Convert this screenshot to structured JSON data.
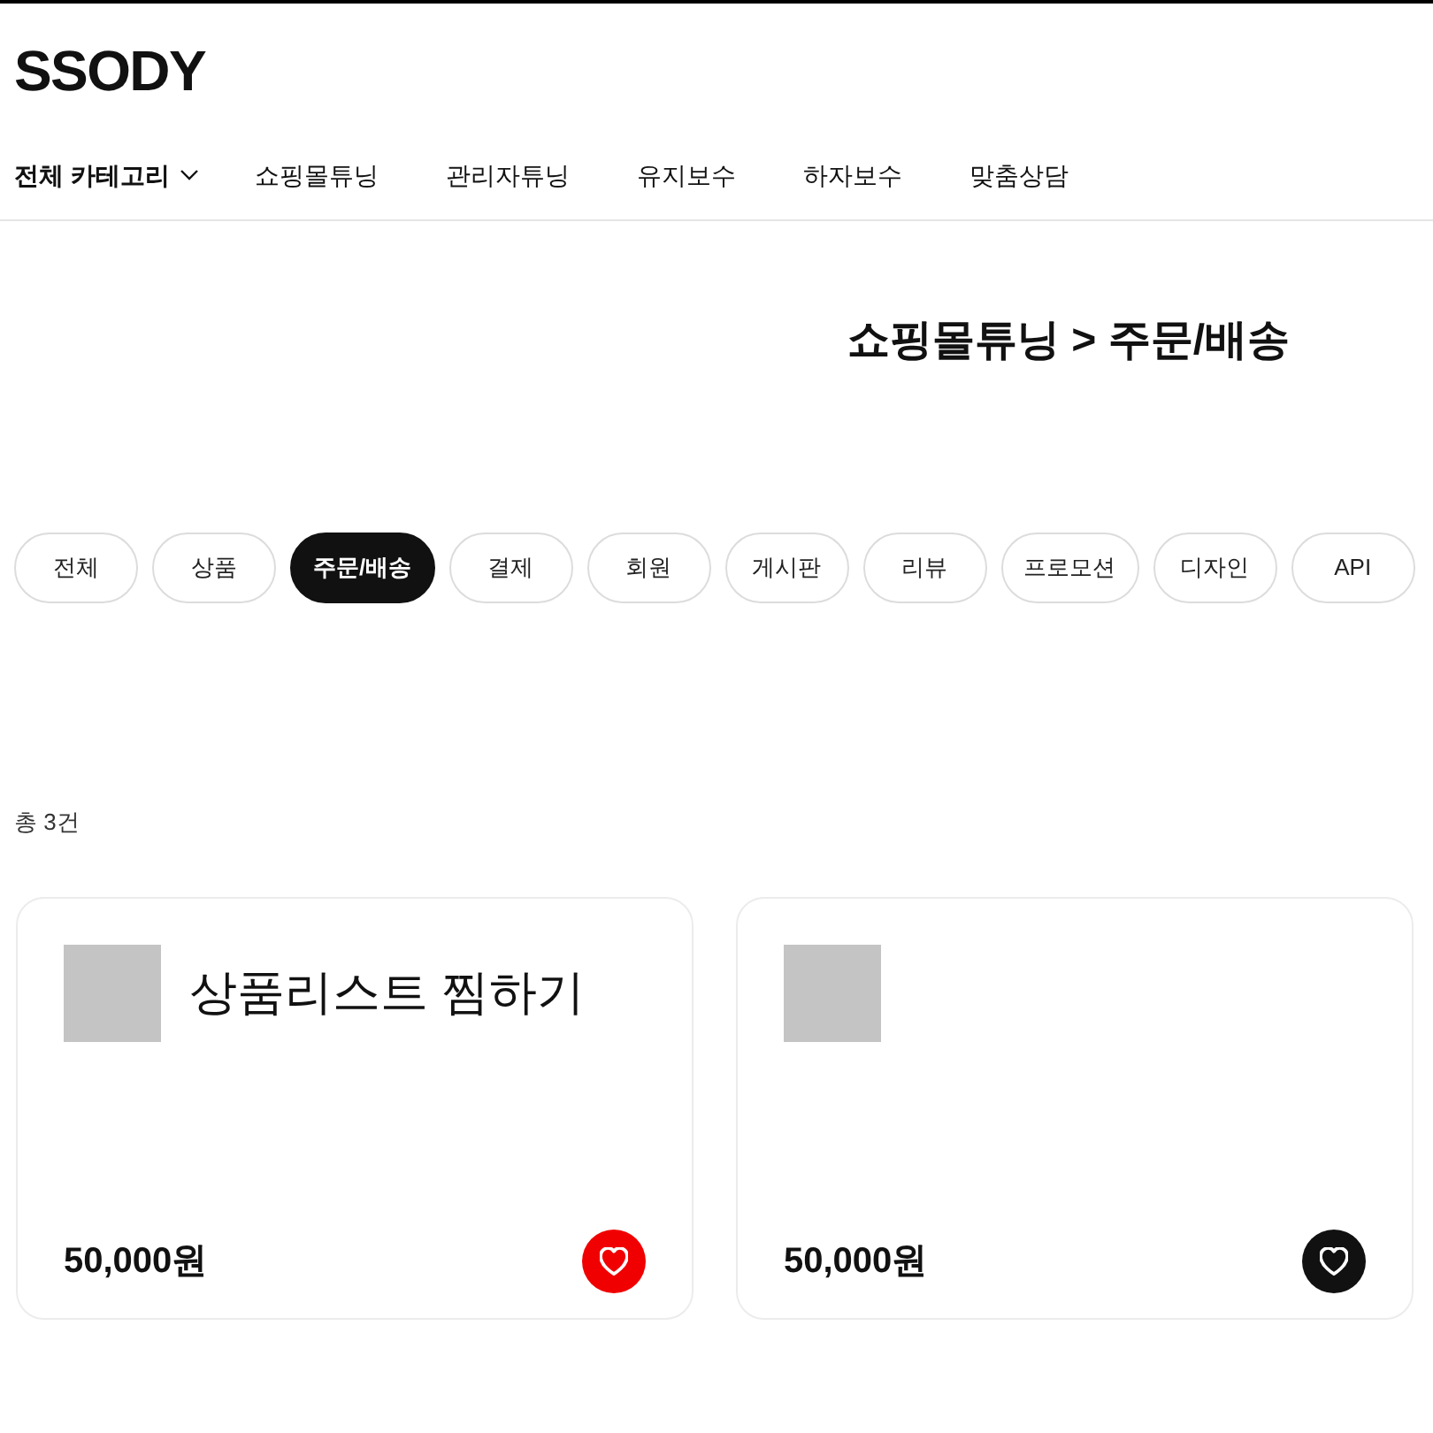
{
  "logo": "SSODY",
  "category_menu": {
    "label": "전체 카테고리"
  },
  "nav_items": [
    "쇼핑몰튜닝",
    "관리자튜닝",
    "유지보수",
    "하자보수",
    "맞춤상담"
  ],
  "page_title": "쇼핑몰튜닝 > 주문/배송",
  "filter_chips": [
    {
      "label": "전체",
      "selected": false
    },
    {
      "label": "상품",
      "selected": false
    },
    {
      "label": "주문/배송",
      "selected": true
    },
    {
      "label": "결제",
      "selected": false
    },
    {
      "label": "회원",
      "selected": false
    },
    {
      "label": "게시판",
      "selected": false
    },
    {
      "label": "리뷰",
      "selected": false
    },
    {
      "label": "프로모션",
      "selected": false
    },
    {
      "label": "디자인",
      "selected": false
    },
    {
      "label": "API",
      "selected": false
    }
  ],
  "total_count": "총 3건",
  "products": [
    {
      "title": "상품리스트 찜하기",
      "price": "50,000원",
      "liked": true
    },
    {
      "price": "50,000원",
      "liked": false
    }
  ]
}
